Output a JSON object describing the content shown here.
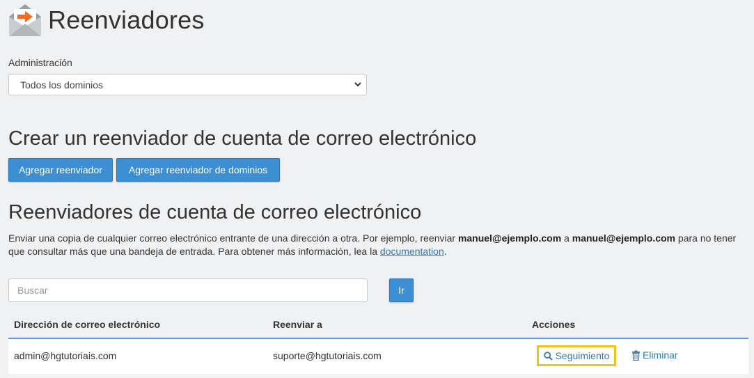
{
  "header": {
    "title": "Reenviadores",
    "icon": "mail-forward-icon"
  },
  "management": {
    "label": "Administración",
    "selected": "Todos los dominios"
  },
  "create_section": {
    "title": "Crear un reenviador de cuenta de correo electrónico",
    "add_button": "Agregar reenviador",
    "add_domain_button": "Agregar reenviador de dominios"
  },
  "list_section": {
    "title": "Reenviadores de cuenta de correo electrónico",
    "description_1": "Enviar una copia de cualquier correo electrónico entrante de una dirección a otra. Por ejemplo, reenviar ",
    "example_from": "manuel@ejemplo.com",
    "description_2": " a ",
    "example_to": "manuel@ejemplo.com",
    "description_3": " para no tener que consultar más que una bandeja de entrada. Para obtener más información, lea la ",
    "doc_link": "documentation",
    "description_4": "."
  },
  "search": {
    "placeholder": "Buscar",
    "value": "",
    "go_button": "Ir"
  },
  "table": {
    "columns": [
      "Dirección de correo electrónico",
      "Reenviar a",
      "Acciones"
    ],
    "rows": [
      {
        "address": "admin@hgtutoriais.com",
        "forward_to": "suporte@hgtutoriais.com",
        "track_label": "Seguimiento",
        "delete_label": "Eliminar"
      }
    ]
  },
  "colors": {
    "primary_button": "#3d8fd4",
    "link": "#2b7bbd",
    "highlight": "#f0c419",
    "logo_arrow": "#f26b21"
  }
}
